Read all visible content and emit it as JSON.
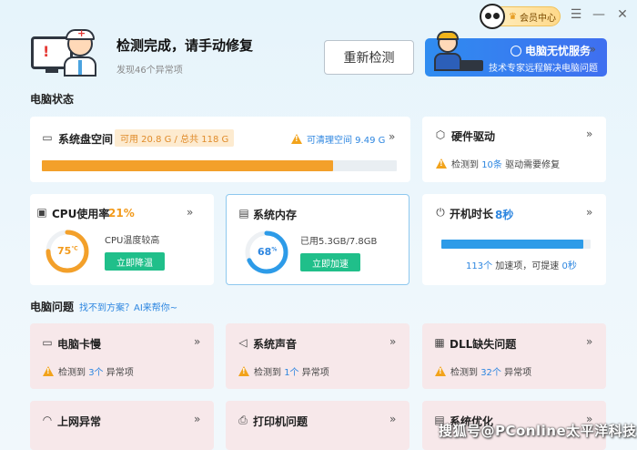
{
  "topbar": {
    "vip_label": "会员中心",
    "menu_icon": "menu-icon",
    "minimize_icon": "minimize-icon",
    "close_icon": "close-icon"
  },
  "header": {
    "title": "检测完成，请手动修复",
    "subtitle": "发现46个异常项",
    "recheck_button": "重新检测",
    "service": {
      "title": "电脑无忧服务",
      "desc": "技术专家远程解决电脑问题",
      "chevron": "»"
    }
  },
  "status_section": {
    "title": "电脑状态"
  },
  "disk": {
    "label": "系统盘空间",
    "usage_tag": "可用 20.8 G / 总共 118 G",
    "cleanable": "可清理空间 9.49 G",
    "chevron": "»",
    "used_fraction": 0.82,
    "bar_color": "#f3a02a"
  },
  "driver": {
    "label": "硬件驱动",
    "chevron": "»",
    "text_pre": "检测到",
    "count": "10条",
    "text_post": "驱动需要修复"
  },
  "cpu": {
    "label": "CPU使用率",
    "percent": "21%",
    "chevron": "»",
    "temp": "75",
    "temp_unit": "℃",
    "temp_fraction": 0.75,
    "status": "CPU温度较高",
    "button": "立即降温",
    "ring_color": "#f3a02a"
  },
  "memory": {
    "label": "系统内存",
    "percent": "68",
    "percent_unit": "%",
    "fraction": 0.68,
    "status": "已用5.3GB/7.8GB",
    "button": "立即加速",
    "ring_color": "#2d9be8"
  },
  "boot": {
    "label": "开机时长",
    "value": "8秒",
    "chevron": "»",
    "fraction": 0.95,
    "count": "113个",
    "text_mid": "加速项，可提速",
    "speedup": "0秒",
    "bar_color": "#2d9be8"
  },
  "problems_section": {
    "title": "电脑问题",
    "link": "找不到方案？AI来帮你~"
  },
  "problems": [
    {
      "icon": "monitor-icon",
      "label": "电脑卡慢",
      "chevron": "»",
      "text_pre": "检测到",
      "count": "3个",
      "text_post": "异常项"
    },
    {
      "icon": "speaker-icon",
      "label": "系统声音",
      "chevron": "»",
      "text_pre": "检测到",
      "count": "1个",
      "text_post": "异常项"
    },
    {
      "icon": "dll-icon",
      "label": "DLL缺失问题",
      "chevron": "»",
      "text_pre": "检测到",
      "count": "32个",
      "text_post": "异常项"
    },
    {
      "icon": "wifi-icon",
      "label": "上网异常",
      "chevron": "»"
    },
    {
      "icon": "printer-icon",
      "label": "打印机问题",
      "chevron": "»"
    },
    {
      "icon": "optimize-icon",
      "label": "系统优化",
      "chevron": "»"
    }
  ],
  "watermark": "搜狐号@PConline太平洋科技"
}
